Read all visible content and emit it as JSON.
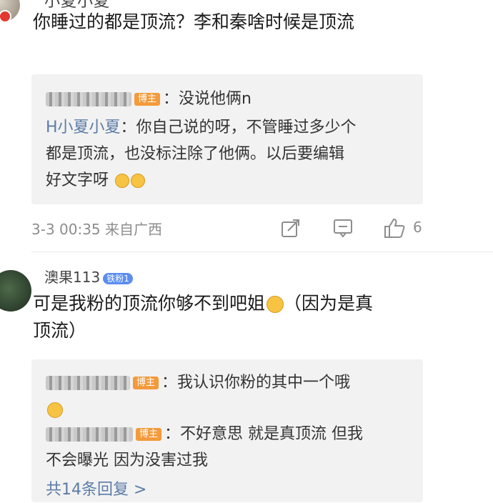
{
  "comment1": {
    "username": "小夏小夏",
    "text": "你睡过的都是顶流？李和秦啥时候是顶流",
    "replies": [
      {
        "author_badge": "博主",
        "text": "：没说他俩n"
      },
      {
        "author": "H小夏小夏",
        "text_lines": [
          "：你自己说的呀，不管睡过多少个",
          "都是顶流，也没标注除了他俩。以后要编辑",
          "好文字呀"
        ]
      }
    ],
    "meta": "3-3 00:35 来自广西",
    "like_count": "6"
  },
  "comment2": {
    "username": "澳果113",
    "fan_badge": "铁粉1",
    "text_lines": [
      "可是我粉的顶流你够不到吧姐",
      "（因为是真",
      "顶流）"
    ],
    "replies": [
      {
        "author_badge": "博主",
        "text": "：我认识你粉的其中一个哦"
      },
      {
        "author_badge": "博主",
        "text_lines": [
          "：不好意思 就是真顶流 但我",
          "不会曝光 因为没害过我"
        ]
      }
    ],
    "more_replies": "共14条回复 >"
  },
  "icons": {
    "share": "share-icon",
    "comment": "comment-icon",
    "like": "thumbs-up-icon"
  }
}
